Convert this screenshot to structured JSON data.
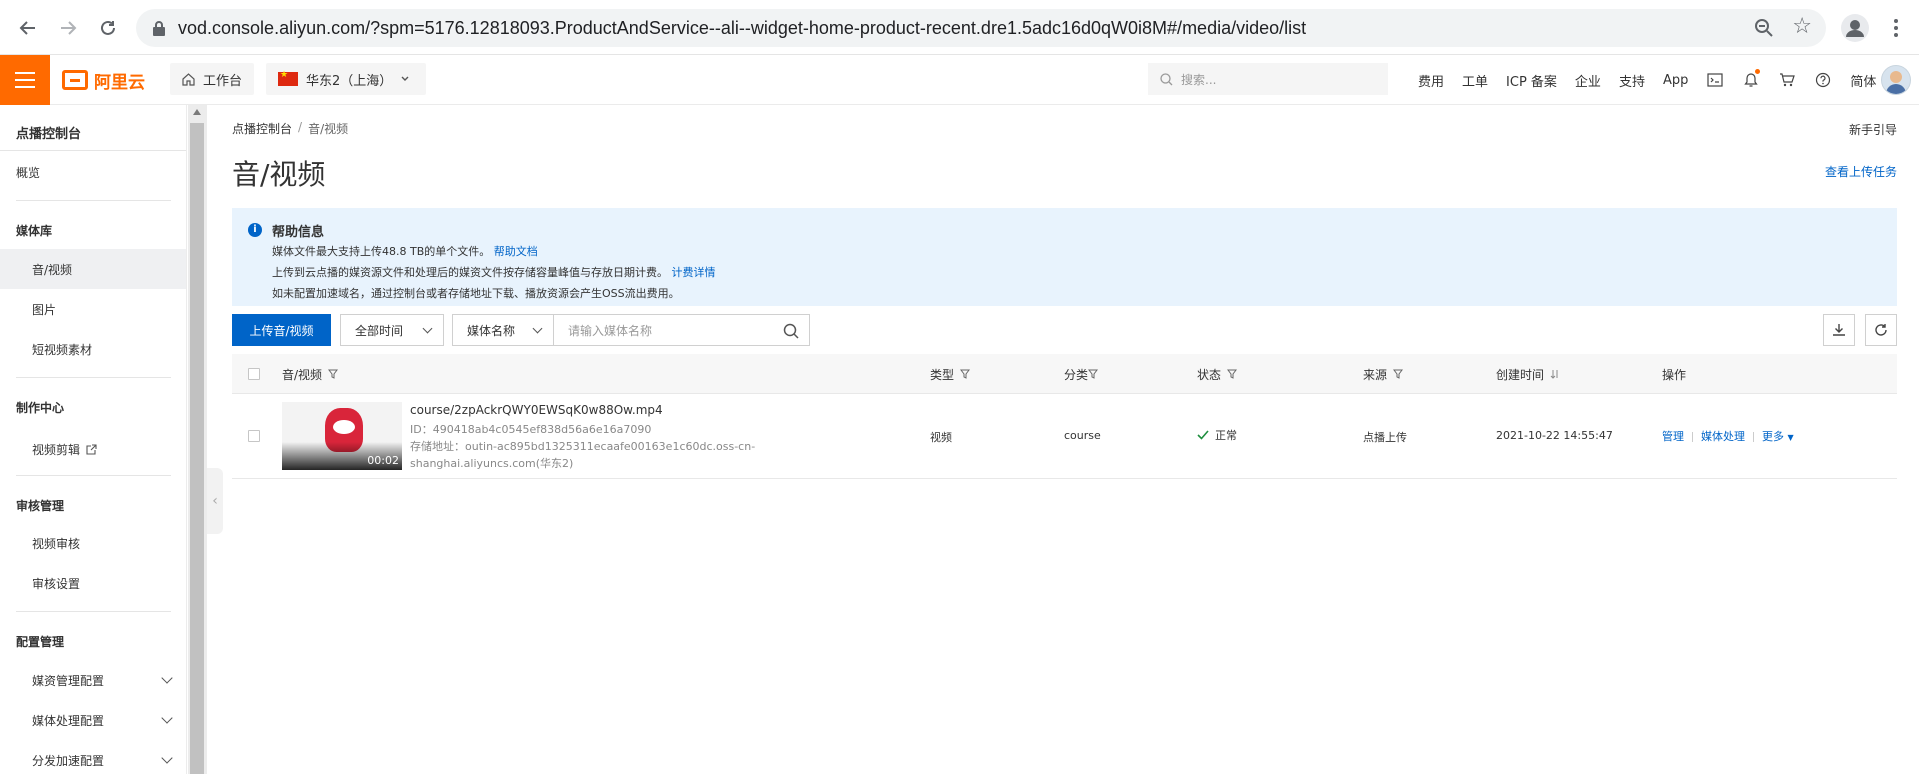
{
  "browser": {
    "url": "vod.console.aliyun.com/?spm=5176.12818093.ProductAndService--ali--widget-home-product-recent.dre1.5adc16d0qW0i8M#/media/video/list"
  },
  "topnav": {
    "logo_text": "阿里云",
    "workbench": "工作台",
    "region": "华东2（上海）",
    "search_placeholder": "搜索...",
    "links": [
      "费用",
      "工单",
      "ICP 备案",
      "企业",
      "支持",
      "App"
    ],
    "lang": "简体",
    "accent": "#ff6a00"
  },
  "sidebar": {
    "header": "点播控制台",
    "overview": "概览",
    "media_lib": "媒体库",
    "media_items": [
      "音/视频",
      "图片",
      "短视频素材"
    ],
    "production": "制作中心",
    "video_edit": "视频剪辑",
    "review": "审核管理",
    "review_items": [
      "视频审核",
      "审核设置"
    ],
    "config": "配置管理",
    "config_items": [
      "媒资管理配置",
      "媒体处理配置",
      "分发加速配置"
    ]
  },
  "main": {
    "breadcrumb": [
      "点播控制台",
      "/",
      "音/视频"
    ],
    "guide": "新手引导",
    "title": "音/视频",
    "upload_tasks": "查看上传任务",
    "help": {
      "title": "帮助信息",
      "line1": "媒体文件最大支持上传48.8 TB的单个文件。",
      "line1_link": "帮助文档",
      "line2": "上传到云点播的媒资源文件和处理后的媒资文件按存储容量峰值与存放日期计费。",
      "line2_link": "计费详情",
      "line3": "如未配置加速域名，通过控制台或者存储地址下载、播放资源会产生OSS流出费用。"
    },
    "toolbar": {
      "upload": "上传音/视频",
      "time_select": "全部时间",
      "field_select": "媒体名称",
      "search_placeholder": "请输入媒体名称"
    },
    "table": {
      "headers": [
        "音/视频",
        "类型",
        "分类",
        "状态",
        "来源",
        "创建时间",
        "操作"
      ],
      "row": {
        "name": "course/2zpAckrQWY0EWSqK0w88Ow.mp4",
        "id": "ID：490418ab4c0545ef838d56a6e16a7090",
        "storage1": "存储地址：outin-ac895bd1325311ecaafe00163e1c60dc.oss-cn-",
        "storage2": "shanghai.aliyuncs.com(华东2)",
        "duration": "00:02",
        "type": "视频",
        "category": "course",
        "status": "正常",
        "source": "点播上传",
        "created": "2021-10-22 14:55:47",
        "actions": [
          "管理",
          "媒体处理",
          "更多"
        ]
      }
    }
  }
}
